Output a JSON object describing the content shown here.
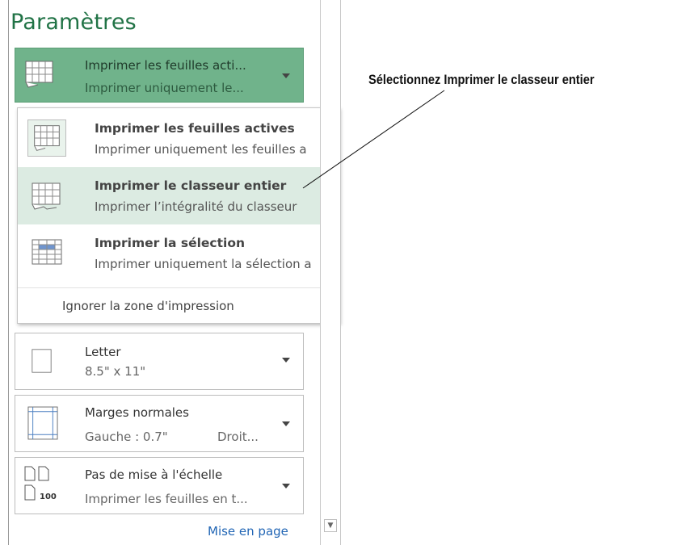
{
  "panel": {
    "title": "Paramètres"
  },
  "print_what": {
    "line1": "Imprimer les feuilles acti...",
    "line2": "Imprimer uniquement le...",
    "icon": "sheet-icon"
  },
  "menu": {
    "items": [
      {
        "title": "Imprimer les feuilles actives",
        "desc": "Imprimer uniquement les feuilles a",
        "icon": "active-sheets-icon"
      },
      {
        "title": "Imprimer le classeur entier",
        "desc": "Imprimer l’intégralité du classeur",
        "icon": "entire-workbook-icon"
      },
      {
        "title": "Imprimer la sélection",
        "desc": "Imprimer uniquement la sélection a",
        "icon": "selection-icon"
      }
    ],
    "ignore_print_area": "Ignorer la zone d'impression"
  },
  "paper": {
    "line1": "Letter",
    "line2": "8.5\" x 11\""
  },
  "margins": {
    "line1": "Marges normales",
    "line2_left": "Gauche :  0.7\"",
    "line2_right": "Droit..."
  },
  "scaling": {
    "line1": "Pas de mise à l'échelle",
    "line2": "Imprimer les feuilles en t...",
    "badge": "100"
  },
  "page_setup_link": "Mise en page",
  "callout": "Sélectionnez Imprimer le classeur entier",
  "colors": {
    "accent": "#217346",
    "selected": "#70b38b",
    "highlight": "#dcebe2",
    "link": "#2266b5"
  }
}
